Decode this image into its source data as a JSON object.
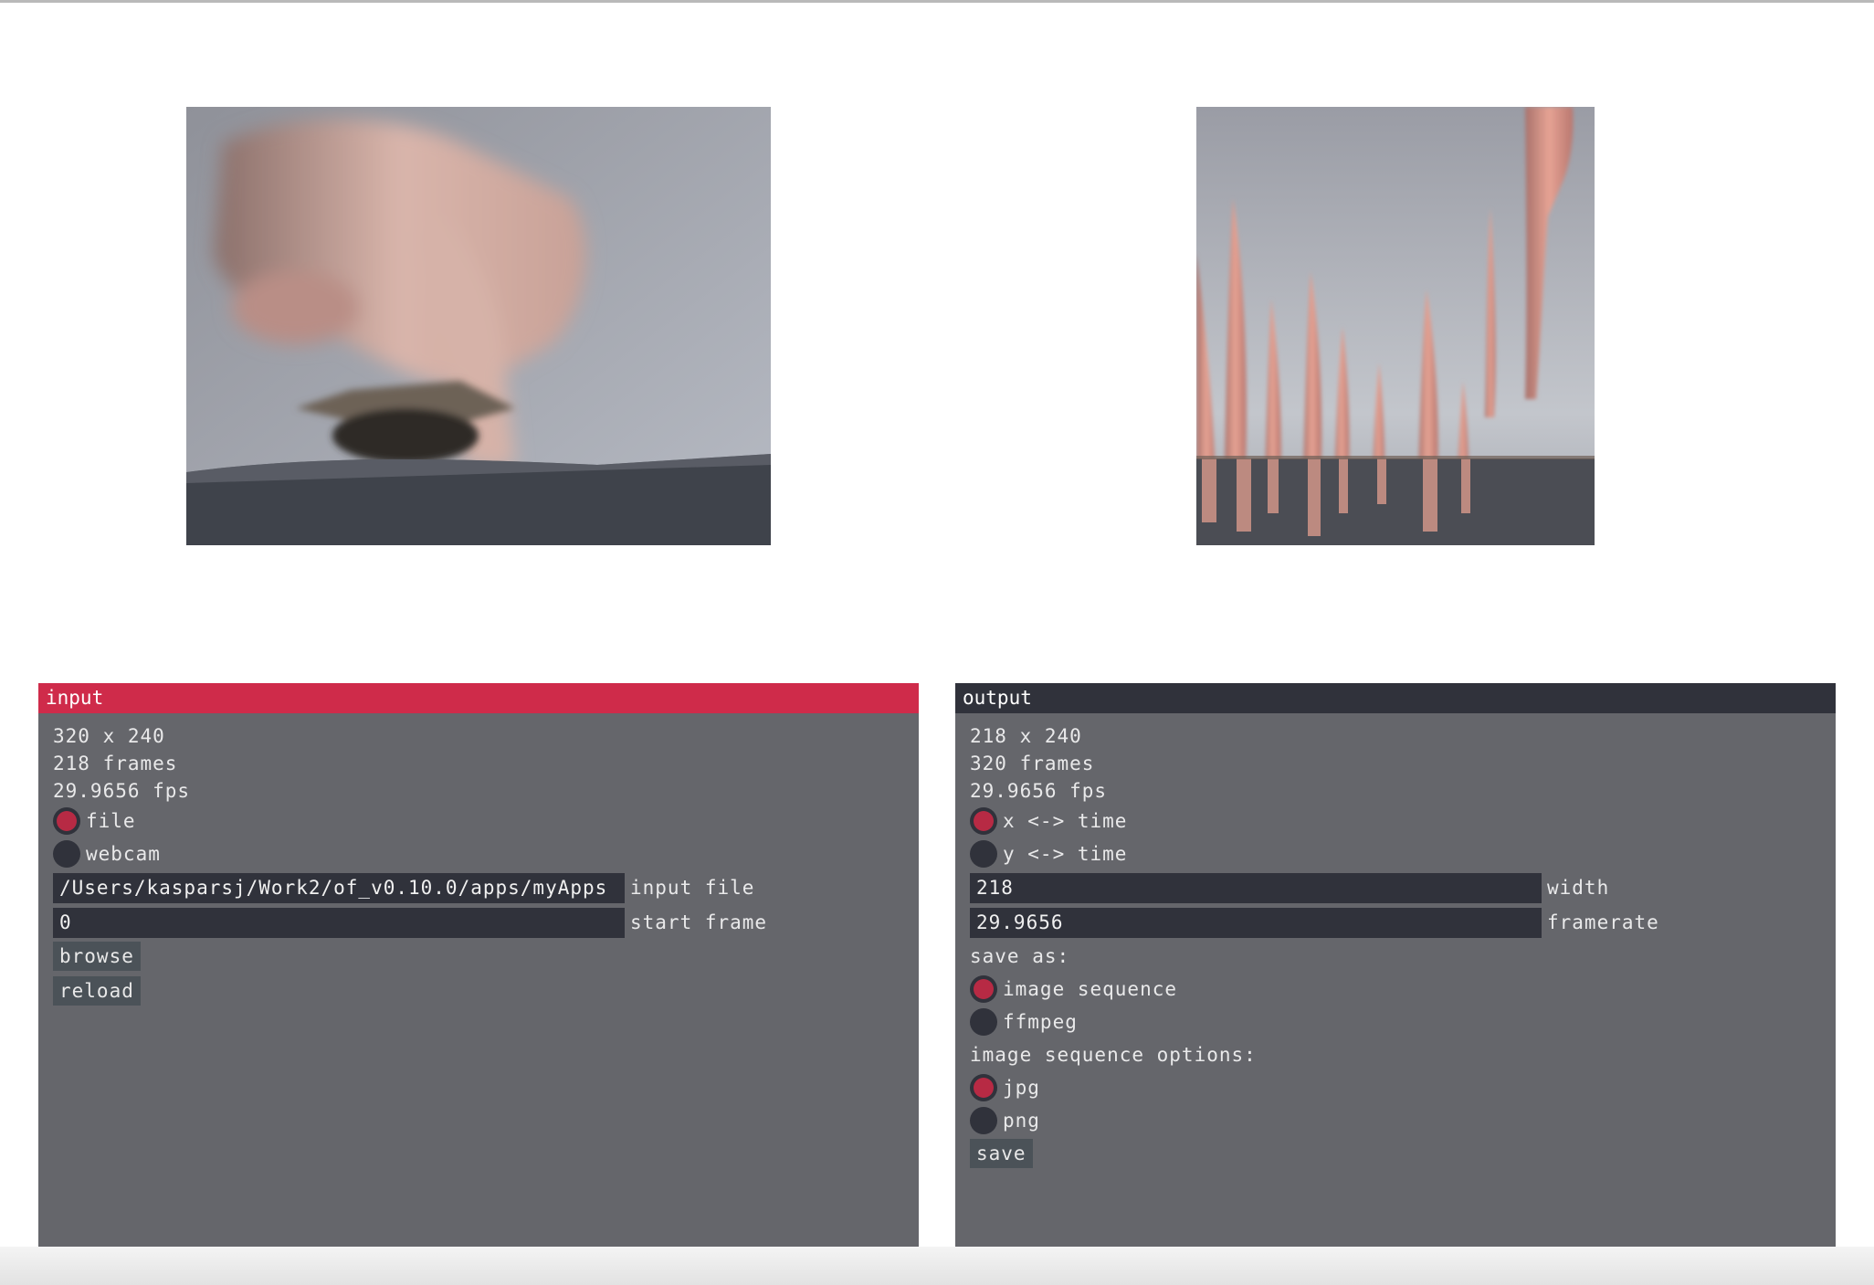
{
  "input": {
    "title": "input",
    "dimensions": "320 x 240",
    "frames": "218 frames",
    "fps": "29.9656 fps",
    "source_options": [
      {
        "label": "file",
        "selected": true
      },
      {
        "label": "webcam",
        "selected": false
      }
    ],
    "input_file": {
      "value": "/Users/kasparsj/Work2/of_v0.10.0/apps/myApps",
      "label": "input file"
    },
    "start_frame": {
      "value": "0",
      "label": "start frame"
    },
    "browse_label": "browse",
    "reload_label": "reload"
  },
  "output": {
    "title": "output",
    "dimensions": "218 x 240",
    "frames": "320 frames",
    "fps": "29.9656 fps",
    "mode_options": [
      {
        "label": "x <-> time",
        "selected": true
      },
      {
        "label": "y <-> time",
        "selected": false
      }
    ],
    "width": {
      "value": "218",
      "label": "width"
    },
    "framerate": {
      "value": "29.9656",
      "label": "framerate"
    },
    "save_as_label": "save as:",
    "save_as_options": [
      {
        "label": "image sequence",
        "selected": true
      },
      {
        "label": "ffmpeg",
        "selected": false
      }
    ],
    "image_sequence_options_label": "image sequence options:",
    "format_options": [
      {
        "label": "jpg",
        "selected": true
      },
      {
        "label": "png",
        "selected": false
      }
    ],
    "save_label": "save"
  },
  "colors": {
    "panel_bg": "#65666b",
    "input_header": "#cf2b4a",
    "output_header": "#30323b",
    "field_bg": "#30323b",
    "radio_on": "#b72a44"
  }
}
